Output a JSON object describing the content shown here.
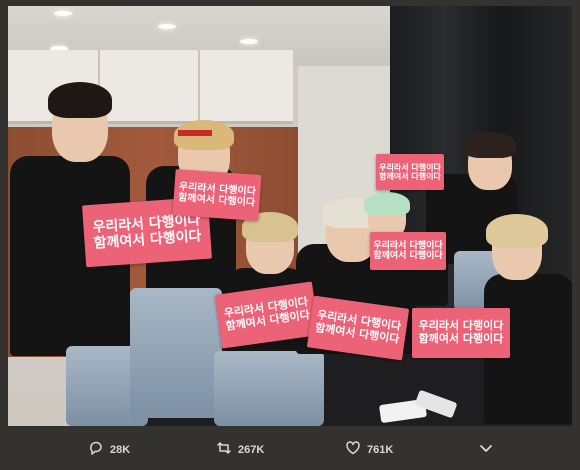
{
  "photo": {
    "signs": [
      {
        "line1": "우리라서 다행이다",
        "line2": "함께여서 다행이다"
      },
      {
        "line1": "우리라서 다행이다",
        "line2": "함께여서 다행이다"
      },
      {
        "line1": "우리라서 다행이다",
        "line2": "함께여서 다행이다"
      },
      {
        "line1": "우리라서 다행이다",
        "line2": "함께여서 다행이다"
      },
      {
        "line1": "우리라서 다행이다",
        "line2": "함께여서 다행이다"
      },
      {
        "line1": "우리라서 다행이다",
        "line2": "함께여서 다행이다"
      },
      {
        "line1": "우리라서 다행이다",
        "line2": "함께여서 다행이다"
      }
    ]
  },
  "actions": {
    "reply": {
      "icon": "reply-icon",
      "count": "28K"
    },
    "retweet": {
      "icon": "retweet-icon",
      "count": "267K"
    },
    "like": {
      "icon": "heart-icon",
      "count": "761K"
    },
    "more": {
      "icon": "chevron-down-icon"
    }
  },
  "colors": {
    "background": "#34322f",
    "sign_pink": "#ec6277",
    "action_text": "#d9d9d9"
  }
}
